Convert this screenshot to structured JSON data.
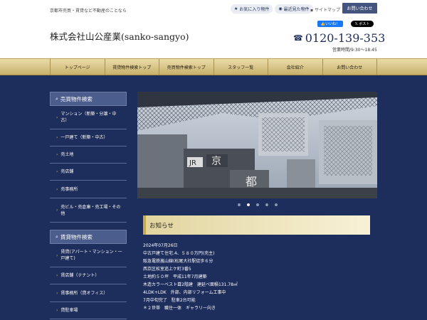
{
  "header": {
    "tagline": "京都市売買・賃貸など不動産のことなら",
    "links": [
      {
        "icon": "star-icon",
        "label": "お気に入り物件"
      },
      {
        "icon": "eye-icon",
        "label": "最近見た物件"
      }
    ],
    "sitemap": "サイトマップ",
    "contact": "お問い合わせ",
    "company": "株式会社山公産業(sanko-sangyo)",
    "phone": "0120-139-353",
    "hours": "営業時間/9:30～18:45",
    "fb_like": "いいね！",
    "x_post": "ポスト"
  },
  "nav": [
    "トップページ",
    "賃貸物件検索トップ",
    "売買物件検索トップ",
    "スタッフ一覧",
    "会社紹介",
    "お問い合わせ"
  ],
  "sidebar": {
    "sale_title": "売買物件検索",
    "sale_items": [
      "マンション（新築・分譲・中古）",
      "一戸建て（新築・中古）",
      "売土地",
      "売店舗",
      "売事務所",
      "売ビル・売倉庫・売工場・その他"
    ],
    "rent_title": "賃貸物件検索",
    "rent_items": [
      "賃貸(アパート・マンション・一戸建て)",
      "賃店舗（テナント）",
      "賃事務所（貸オフィス）",
      "貸駐車場"
    ]
  },
  "hero": {
    "station_sign": "京都",
    "jr_mark": "JR",
    "slides": 5,
    "active_slide": 2
  },
  "news": {
    "title": "お知らせ",
    "lines": [
      "2024年07月26日",
      "中古戸建て住宅.4、５８０万円(売主)",
      "阪急電鉄嵐山線(松尾大社駅徒歩６分",
      "西京区松室追上ケ町3番5",
      "土地約５０坪　平成11年7月建築",
      "木造カラーベスト葺2階建　建延べ面積131.78㎡",
      "4LDK+LDK　外部、内部リフォーム工事中",
      "7月中旬完了　駐車2台可能",
      "＊２世帯　職住一体　ギャラリー向き"
    ]
  }
}
